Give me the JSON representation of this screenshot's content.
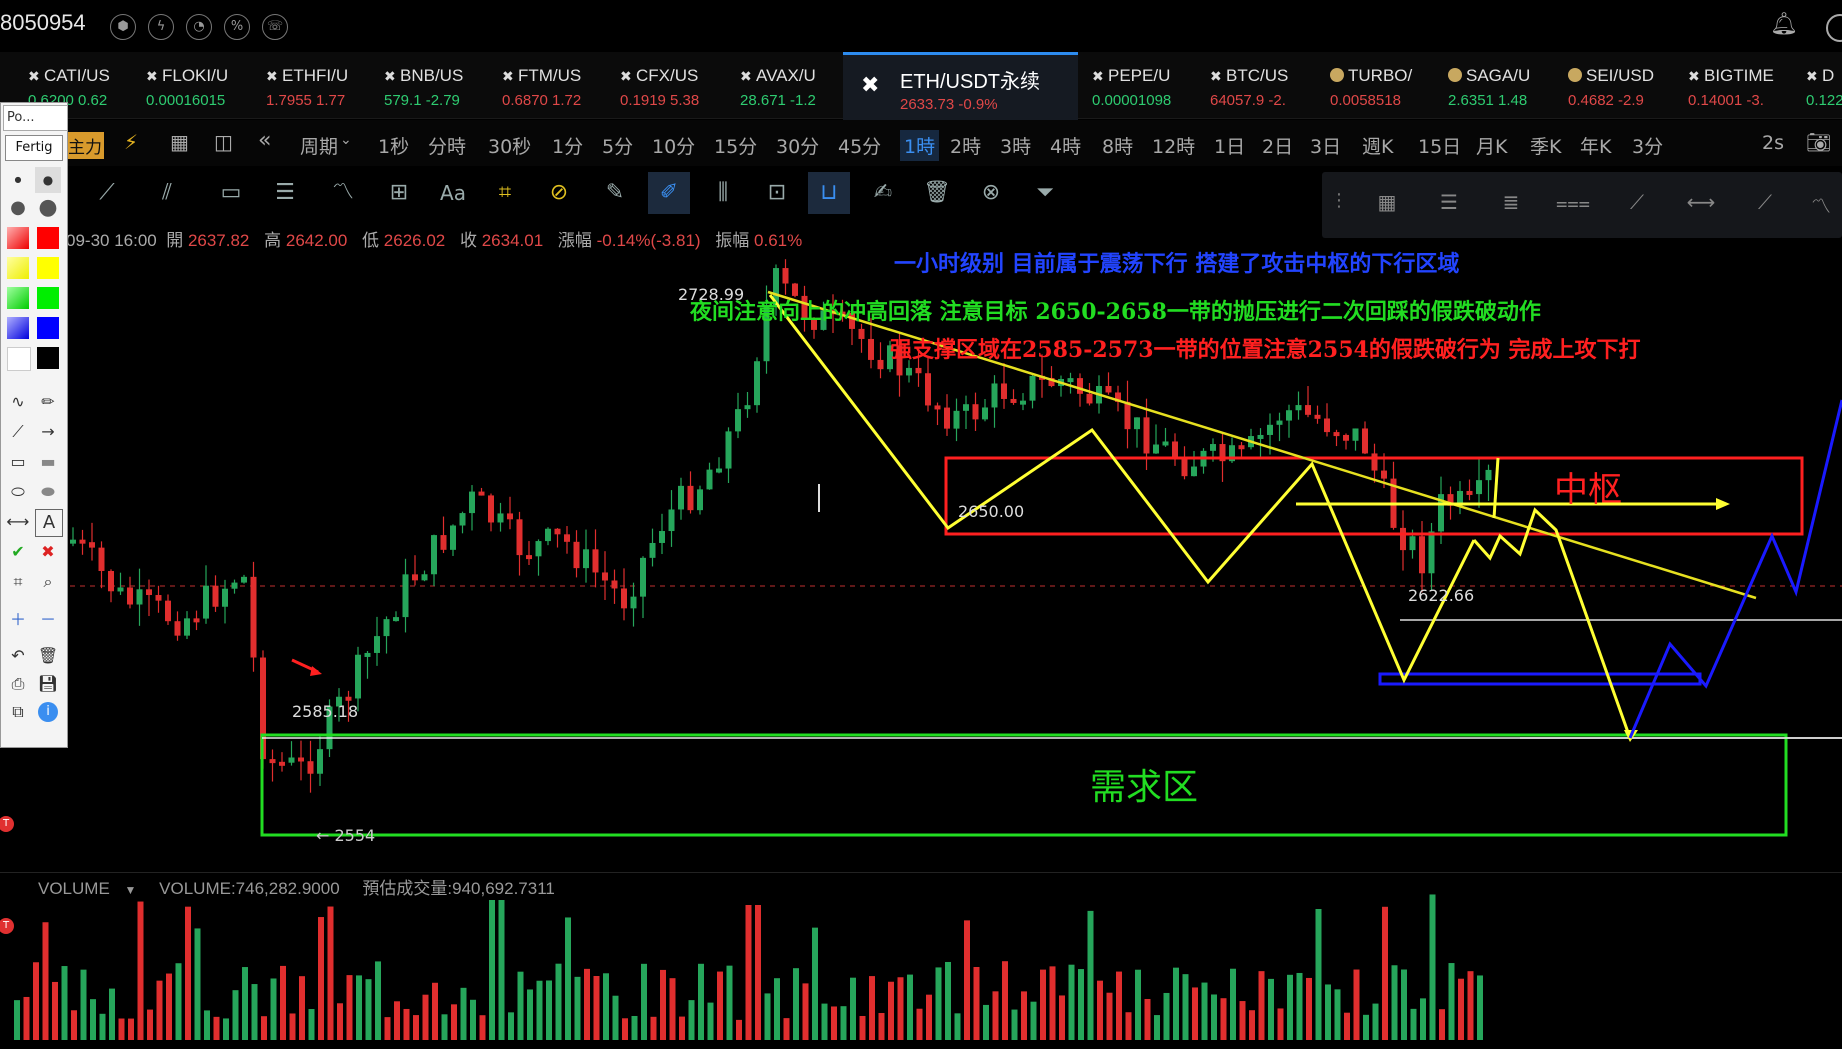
{
  "header": {
    "account_id": "8050954"
  },
  "tickers": [
    {
      "name": "CATI/US",
      "value": "0.6200 0.62",
      "color": "#2ecc71"
    },
    {
      "name": "FLOKI/U",
      "value": "0.00016015",
      "color": "#2ecc71"
    },
    {
      "name": "ETHFI/U",
      "value": "1.7955 1.77",
      "color": "#e04848"
    },
    {
      "name": "BNB/US",
      "value": "579.1 -2.79",
      "color": "#2ecc71"
    },
    {
      "name": "FTM/US",
      "value": "0.6870 1.72",
      "color": "#e04848"
    },
    {
      "name": "CFX/US",
      "value": "0.1919 5.38",
      "color": "#e04848"
    },
    {
      "name": "AVAX/U",
      "value": "28.671 -1.2",
      "color": "#2ecc71"
    },
    {
      "name": "PEPE/U",
      "value": "0.00001098",
      "color": "#2ecc71"
    },
    {
      "name": "BTC/US",
      "value": "64057.9 -2.",
      "color": "#e04848"
    },
    {
      "name": "TURBO/",
      "value": "0.0058518",
      "color": "#e04848"
    },
    {
      "name": "SAGA/U",
      "value": "2.6351 1.48",
      "color": "#2ecc71"
    },
    {
      "name": "SEI/USD",
      "value": "0.4682 -2.9",
      "color": "#e04848"
    },
    {
      "name": "BIGTIME",
      "value": "0.14001 -3.",
      "color": "#e04848"
    },
    {
      "name": "D",
      "value": "0.122",
      "color": "#2ecc71"
    }
  ],
  "active_ticker": {
    "name": "ETH/USDT永续",
    "value": "2633.73  -0.9%"
  },
  "period_bar": {
    "main_label": "主力",
    "cycle_label": "周期",
    "periods": [
      "1秒",
      "分時",
      "30秒",
      "1分",
      "5分",
      "10分",
      "15分",
      "30分",
      "45分",
      "1時",
      "2時",
      "3時",
      "4時",
      "8時",
      "12時",
      "1日",
      "2日",
      "3日",
      "週K",
      "15日",
      "月K",
      "季K",
      "年K",
      "3分"
    ],
    "active": "1時",
    "refresh": "2s"
  },
  "palette": {
    "title": "Po...",
    "button": "Fertig",
    "text_tool": "A"
  },
  "ohlc": {
    "time": "09-30 16:00",
    "open_label": "開",
    "open": "2637.82",
    "high_label": "高",
    "high": "2642.00",
    "low_label": "低",
    "low": "2626.02",
    "close_label": "收",
    "close": "2634.01",
    "change_label": "漲幅",
    "change": "-0.14%(-3.81)",
    "amp_label": "振幅",
    "amp": "0.61%"
  },
  "annotations": {
    "line1": "一小时级别 目前属于震荡下行 搭建了攻击中枢的下行区域",
    "line2": "夜间注意向上的冲高回落 注意目标 2650-2658一带的抛压进行二次回踩的假跌破动作",
    "line3": "强支撑区域在2585-2573一带的位置注意2554的假跌破行为 完成上攻下打",
    "pivot_zone": "中枢",
    "demand_zone": "需求区"
  },
  "price_labels": {
    "high": "2728.99",
    "pivot": "2650.00",
    "current": "2622.66",
    "support": "2585.18",
    "low": "← 2554"
  },
  "volume": {
    "title": "VOLUME",
    "value": "VOLUME:746,282.9000",
    "estimate": "預估成交量:940,692.7311"
  },
  "colors": {
    "up": "#26a65b",
    "down": "#e02e2e",
    "accent": "#2d8cf0",
    "pivot_box": "#ff2020",
    "demand_box": "#22dd22",
    "trend_path": "#ffff33",
    "projection": "#1a1aff"
  }
}
